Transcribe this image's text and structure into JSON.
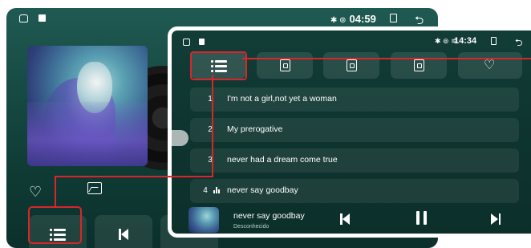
{
  "back_screen": {
    "time": "04:59",
    "status_icons": "✱ ⊚"
  },
  "front_screen": {
    "status_icons": "✱ ⊚ ≋",
    "time": "14:34",
    "playlist": [
      {
        "index": "1",
        "title": "I'm not a girl,not yet a woman"
      },
      {
        "index": "2",
        "title": "My prerogative"
      },
      {
        "index": "3",
        "title": "never had a dream come true"
      },
      {
        "index": "4",
        "title": "never say goodbay",
        "playing": true
      }
    ],
    "now_playing": {
      "title": "never say goodbay",
      "artist": "Desconhecido"
    }
  },
  "colors": {
    "highlight": "#d8262a",
    "panel_bg": "#0f3530"
  },
  "icons": {
    "heart": "♡",
    "return": "⮌"
  }
}
